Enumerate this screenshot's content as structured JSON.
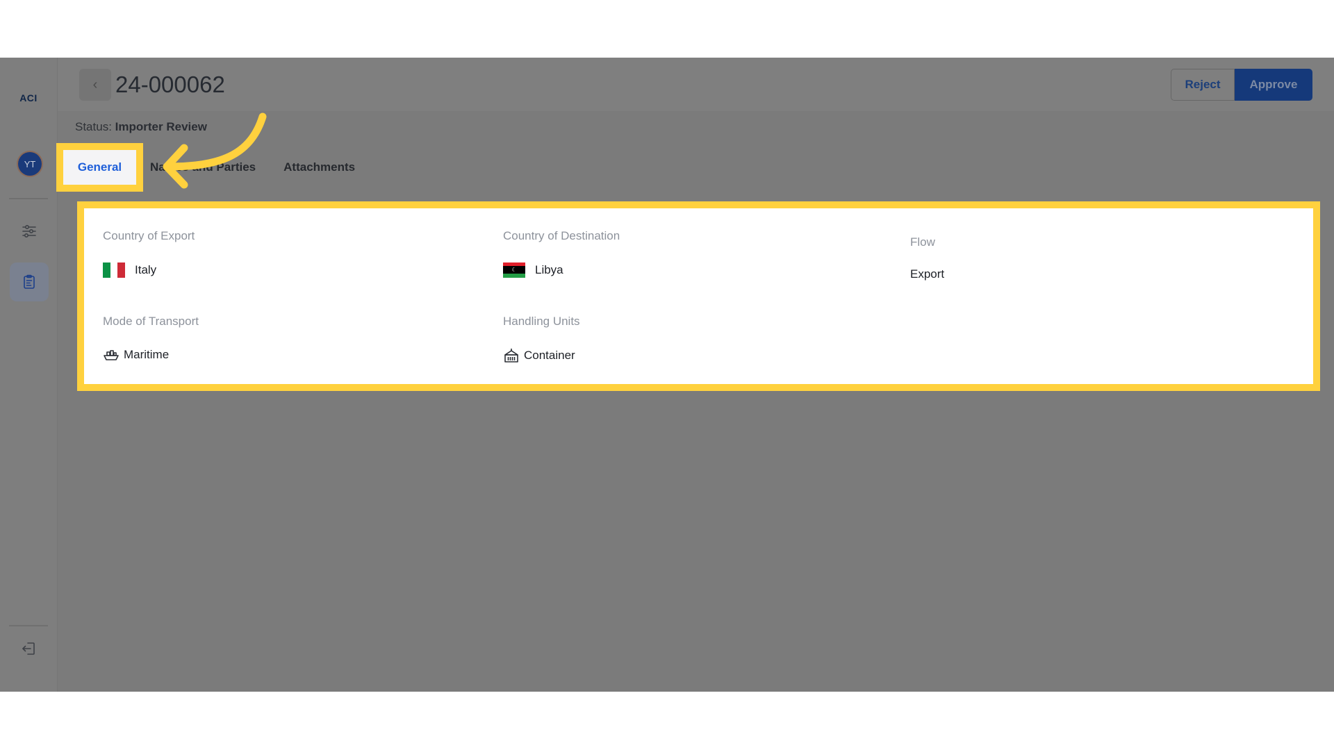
{
  "sidebar": {
    "logo": "ACI",
    "avatar_initials": "YT",
    "items": [
      {
        "name": "filters",
        "icon": "sliders-icon",
        "active": false
      },
      {
        "name": "declarations",
        "icon": "clipboard-icon",
        "active": true
      }
    ],
    "logout_icon": "logout-icon"
  },
  "header": {
    "back_icon": "chevron-left-icon",
    "title": "24-000062",
    "reject_label": "Reject",
    "approve_label": "Approve"
  },
  "status": {
    "prefix": "Status:",
    "value": "Importer Review"
  },
  "tabs": [
    {
      "label": "General",
      "active": true
    },
    {
      "label": "Names and Parties",
      "active": false
    },
    {
      "label": "Attachments",
      "active": false
    }
  ],
  "general": {
    "country_of_export": {
      "label": "Country of Export",
      "value": "Italy",
      "flag": "italy-flag"
    },
    "country_of_destination": {
      "label": "Country of Destination",
      "value": "Libya",
      "flag": "libya-flag"
    },
    "flow": {
      "label": "Flow",
      "value": "Export"
    },
    "mode_of_transport": {
      "label": "Mode of Transport",
      "value": "Maritime",
      "icon": "ship-icon"
    },
    "handling_units": {
      "label": "Handling Units",
      "value": "Container",
      "icon": "container-icon"
    }
  },
  "annotation": {
    "highlight_color": "#ffd13e"
  }
}
